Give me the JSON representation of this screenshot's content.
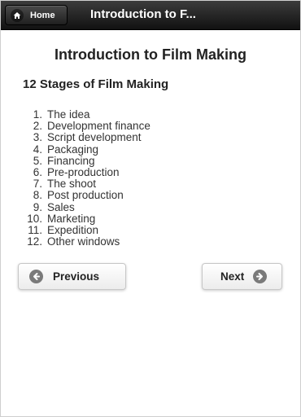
{
  "header": {
    "home_label": "Home",
    "title": "Introduction to F..."
  },
  "page": {
    "title": "Introduction to Film Making",
    "section_title": "12 Stages of Film Making"
  },
  "stages": [
    {
      "number": "1.",
      "label": "The idea"
    },
    {
      "number": "2.",
      "label": "Development finance"
    },
    {
      "number": "3.",
      "label": "Script development"
    },
    {
      "number": "4.",
      "label": "Packaging"
    },
    {
      "number": "5.",
      "label": "Financing"
    },
    {
      "number": "6.",
      "label": "Pre-production"
    },
    {
      "number": "7.",
      "label": "The shoot"
    },
    {
      "number": "8.",
      "label": "Post production"
    },
    {
      "number": "9.",
      "label": "Sales"
    },
    {
      "number": "10.",
      "label": "Marketing"
    },
    {
      "number": "11.",
      "label": "Expedition"
    },
    {
      "number": "12.",
      "label": "Other windows"
    }
  ],
  "nav": {
    "previous_label": "Previous",
    "next_label": "Next"
  },
  "icons": {
    "home": "home-icon",
    "previous": "arrow-left-circle-icon",
    "next": "arrow-right-circle-icon"
  },
  "colors": {
    "header_bg": "#1a1a1a",
    "icon_circle": "#7a7a7a",
    "button_bg": "#f4f4f4"
  }
}
